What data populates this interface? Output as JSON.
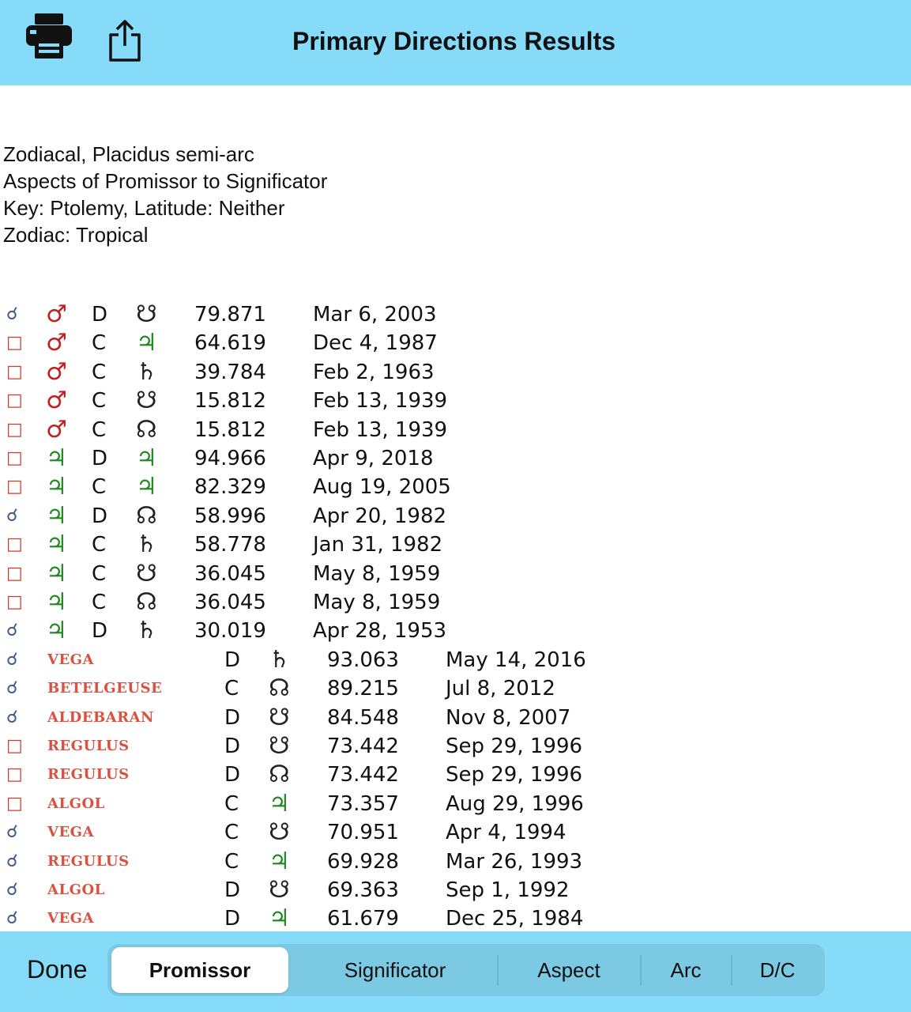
{
  "header": {
    "title": "Primary Directions Results",
    "print_icon": "printer-icon",
    "share_icon": "share-icon"
  },
  "info": {
    "line1": "Zodiacal, Placidus semi-arc",
    "line2": "Aspects of Promissor to Significator",
    "line3": "Key: Ptolemy, Latitude: Neither",
    "line4": "Zodiac: Tropical"
  },
  "glyphs": {
    "conjunction": "☌",
    "square": "□",
    "mars": "♂",
    "jupiter": "♃",
    "saturn": "♄",
    "south_node": "☋",
    "north_node": "☊"
  },
  "colors": {
    "header_bg": "#86dcf8",
    "mars": "#c02020",
    "jupiter": "#1e8a1e",
    "star": "#d95140",
    "square": "#d23a2a",
    "conjunction": "#3f5a8c"
  },
  "planet_rows": [
    {
      "aspect": "☌",
      "aspect_type": "cj",
      "promissor": "♂",
      "prom_type": "mars",
      "dc": "D",
      "significator": "☋",
      "sig_type": "blk",
      "arc": "79.871",
      "date": "Mar 6, 2003"
    },
    {
      "aspect": "□",
      "aspect_type": "sq",
      "promissor": "♂",
      "prom_type": "mars",
      "dc": "C",
      "significator": "♃",
      "sig_type": "jup",
      "arc": "64.619",
      "date": "Dec 4, 1987"
    },
    {
      "aspect": "□",
      "aspect_type": "sq",
      "promissor": "♂",
      "prom_type": "mars",
      "dc": "C",
      "significator": "♄",
      "sig_type": "blk",
      "arc": "39.784",
      "date": "Feb 2, 1963"
    },
    {
      "aspect": "□",
      "aspect_type": "sq",
      "promissor": "♂",
      "prom_type": "mars",
      "dc": "C",
      "significator": "☋",
      "sig_type": "blk",
      "arc": "15.812",
      "date": "Feb 13, 1939"
    },
    {
      "aspect": "□",
      "aspect_type": "sq",
      "promissor": "♂",
      "prom_type": "mars",
      "dc": "C",
      "significator": "☊",
      "sig_type": "blk",
      "arc": "15.812",
      "date": "Feb 13, 1939"
    },
    {
      "aspect": "□",
      "aspect_type": "sq",
      "promissor": "♃",
      "prom_type": "jup",
      "dc": "D",
      "significator": "♃",
      "sig_type": "jup",
      "arc": "94.966",
      "date": "Apr 9, 2018"
    },
    {
      "aspect": "□",
      "aspect_type": "sq",
      "promissor": "♃",
      "prom_type": "jup",
      "dc": "C",
      "significator": "♃",
      "sig_type": "jup",
      "arc": "82.329",
      "date": "Aug 19, 2005"
    },
    {
      "aspect": "☌",
      "aspect_type": "cj",
      "promissor": "♃",
      "prom_type": "jup",
      "dc": "D",
      "significator": "☊",
      "sig_type": "blk",
      "arc": "58.996",
      "date": "Apr 20, 1982"
    },
    {
      "aspect": "□",
      "aspect_type": "sq",
      "promissor": "♃",
      "prom_type": "jup",
      "dc": "C",
      "significator": "♄",
      "sig_type": "blk",
      "arc": "58.778",
      "date": "Jan 31, 1982"
    },
    {
      "aspect": "□",
      "aspect_type": "sq",
      "promissor": "♃",
      "prom_type": "jup",
      "dc": "C",
      "significator": "☋",
      "sig_type": "blk",
      "arc": "36.045",
      "date": "May 8, 1959"
    },
    {
      "aspect": "□",
      "aspect_type": "sq",
      "promissor": "♃",
      "prom_type": "jup",
      "dc": "C",
      "significator": "☊",
      "sig_type": "blk",
      "arc": "36.045",
      "date": "May 8, 1959"
    },
    {
      "aspect": "☌",
      "aspect_type": "cj",
      "promissor": "♃",
      "prom_type": "jup",
      "dc": "D",
      "significator": "♄",
      "sig_type": "blk",
      "arc": "30.019",
      "date": "Apr 28, 1953"
    }
  ],
  "star_rows": [
    {
      "aspect": "☌",
      "aspect_type": "cj",
      "promissor": "VEGA",
      "dc": "D",
      "significator": "♄",
      "sig_type": "blk",
      "arc": "93.063",
      "date": "May 14, 2016"
    },
    {
      "aspect": "☌",
      "aspect_type": "cj",
      "promissor": "BETELGEUSE",
      "dc": "C",
      "significator": "☊",
      "sig_type": "blk",
      "arc": "89.215",
      "date": "Jul 8, 2012"
    },
    {
      "aspect": "☌",
      "aspect_type": "cj",
      "promissor": "ALDEBARAN",
      "dc": "D",
      "significator": "☋",
      "sig_type": "blk",
      "arc": "84.548",
      "date": "Nov 8, 2007"
    },
    {
      "aspect": "□",
      "aspect_type": "sq",
      "promissor": "REGULUS",
      "dc": "D",
      "significator": "☋",
      "sig_type": "blk",
      "arc": "73.442",
      "date": "Sep 29, 1996"
    },
    {
      "aspect": "□",
      "aspect_type": "sq",
      "promissor": "REGULUS",
      "dc": "D",
      "significator": "☊",
      "sig_type": "blk",
      "arc": "73.442",
      "date": "Sep 29, 1996"
    },
    {
      "aspect": "□",
      "aspect_type": "sq",
      "promissor": "ALGOL",
      "dc": "C",
      "significator": "♃",
      "sig_type": "jup",
      "arc": "73.357",
      "date": "Aug 29, 1996"
    },
    {
      "aspect": "☌",
      "aspect_type": "cj",
      "promissor": "VEGA",
      "dc": "C",
      "significator": "☋",
      "sig_type": "blk",
      "arc": "70.951",
      "date": "Apr 4, 1994"
    },
    {
      "aspect": "☌",
      "aspect_type": "cj",
      "promissor": "REGULUS",
      "dc": "C",
      "significator": "♃",
      "sig_type": "jup",
      "arc": "69.928",
      "date": "Mar 26, 1993"
    },
    {
      "aspect": "☌",
      "aspect_type": "cj",
      "promissor": "ALGOL",
      "dc": "D",
      "significator": "☋",
      "sig_type": "blk",
      "arc": "69.363",
      "date": "Sep 1, 1992"
    },
    {
      "aspect": "☌",
      "aspect_type": "cj",
      "promissor": "VEGA",
      "dc": "D",
      "significator": "♃",
      "sig_type": "jup",
      "arc": "61.679",
      "date": "Dec 25, 1984"
    }
  ],
  "bottom": {
    "done_label": "Done",
    "segments": [
      "Promissor",
      "Significator",
      "Aspect",
      "Arc",
      "D/C"
    ],
    "active_segment": "Promissor"
  }
}
